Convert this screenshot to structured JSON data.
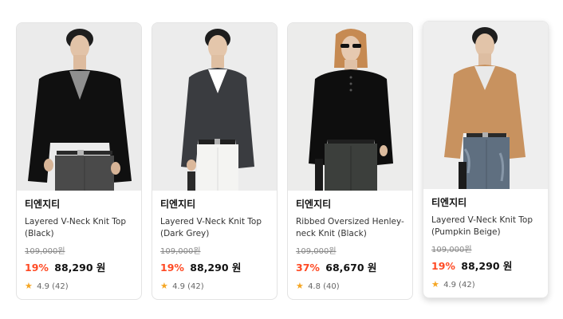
{
  "products": [
    {
      "brand": "티엔지티",
      "name": "Layered V-Neck Knit Top (Black)",
      "original_price": "109,000원",
      "discount": "19%",
      "price": "88,290 원",
      "rating": "4.9",
      "reviews": "(42)"
    },
    {
      "brand": "티엔지티",
      "name": "Layered V-Neck Knit Top (Dark Grey)",
      "original_price": "109,000원",
      "discount": "19%",
      "price": "88,290 원",
      "rating": "4.9",
      "reviews": "(42)"
    },
    {
      "brand": "티엔지티",
      "name": "Ribbed Oversized Henley-neck Knit (Black)",
      "original_price": "109,000원",
      "discount": "37%",
      "price": "68,670 원",
      "rating": "4.8",
      "reviews": "(40)"
    },
    {
      "brand": "티엔지티",
      "name": "Layered V-Neck Knit Top (Pumpkin Beige)",
      "original_price": "109,000원",
      "discount": "19%",
      "price": "88,290 원",
      "rating": "4.9",
      "reviews": "(42)"
    }
  ],
  "colors": {
    "discount": "#ff4a24",
    "star": "#f5a623",
    "card_border": "#e3e3e3"
  },
  "icons": {
    "rating": "star-icon"
  }
}
